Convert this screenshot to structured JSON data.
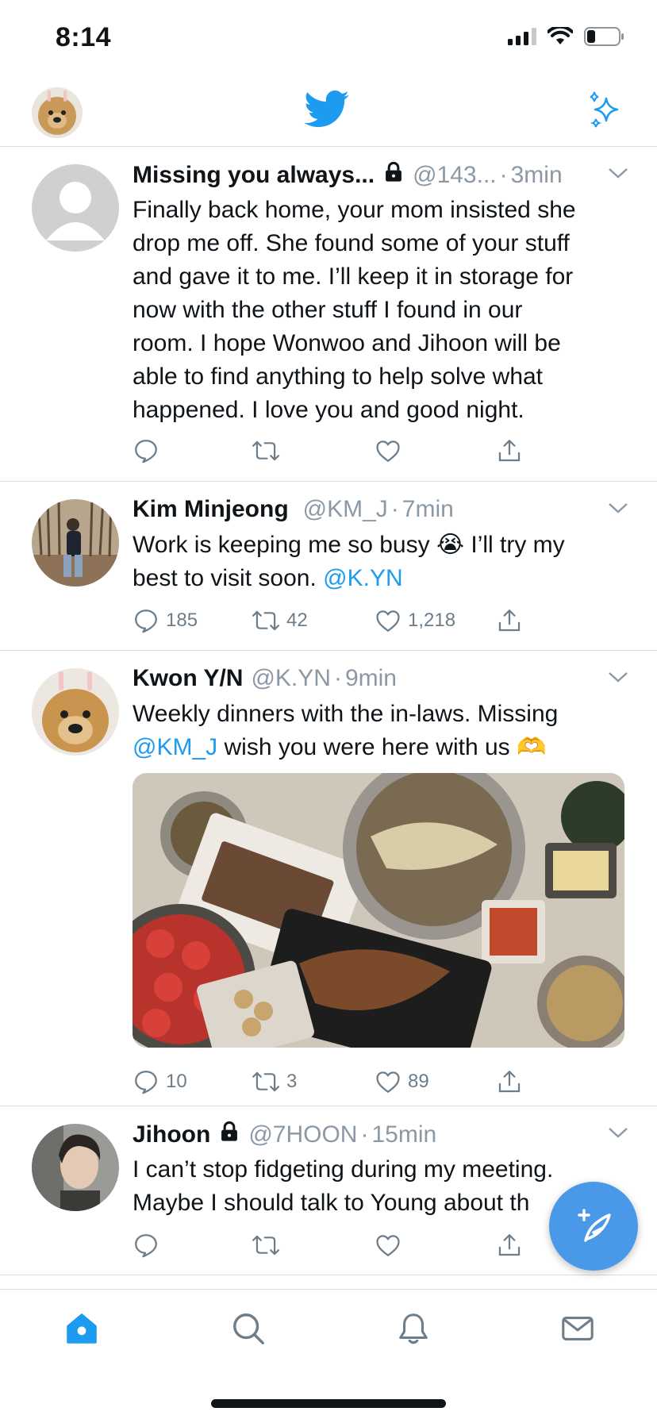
{
  "status_bar": {
    "time": "8:14"
  },
  "tweets": [
    {
      "name": "Missing you always...",
      "protected": true,
      "handle": "@143...",
      "sep": "·",
      "ago": "3min",
      "lines": [
        "Finally back home, your mom insisted she",
        "drop me off. She found some of your stuff",
        "and gave it to me. I’ll keep it in storage for",
        "now with the other stuff I found in our",
        "room. I hope Wonwoo and Jihoon will be",
        "able to find anything to help solve what",
        "happened. I love you and good night."
      ],
      "replies": "",
      "retweets": "",
      "likes": ""
    },
    {
      "name": "Kim Minjeong",
      "protected": false,
      "handle": "@KM_J",
      "sep": "·",
      "ago": "7min",
      "line1": "Work is keeping me so busy",
      "emoji": "😭",
      "line1_after": "I’ll try my",
      "line2": "best to visit soon.",
      "mention": "@K.YN",
      "replies": "185",
      "retweets": "42",
      "likes": "1,218"
    },
    {
      "name": "Kwon Y/N",
      "protected": false,
      "handle": "@K.YN",
      "sep": "·",
      "ago": "9min",
      "line1": "Weekly dinners with the in-laws. Missing",
      "mention": "@KM_J",
      "line2_after": "wish you were here with us",
      "emoji": "🫶",
      "replies": "10",
      "retweets": "3",
      "likes": "89"
    },
    {
      "name": "Jihoon",
      "protected": true,
      "handle": "@7HOON",
      "sep": "·",
      "ago": "15min",
      "line1": "I can’t stop fidgeting during my meeting.",
      "line2": "Maybe I should talk to Young about th",
      "replies": "",
      "retweets": "",
      "likes": ""
    }
  ],
  "colors": {
    "accent": "#1d9bf0",
    "fab": "#4a99e9",
    "muted": "#8b98a5"
  },
  "icons": [
    "twitter-bird-icon",
    "sparkle-icon",
    "lock-icon",
    "chevron-down-icon",
    "reply-icon",
    "retweet-icon",
    "like-icon",
    "share-icon",
    "compose-icon",
    "home-icon",
    "search-icon",
    "bell-icon",
    "mail-icon"
  ]
}
